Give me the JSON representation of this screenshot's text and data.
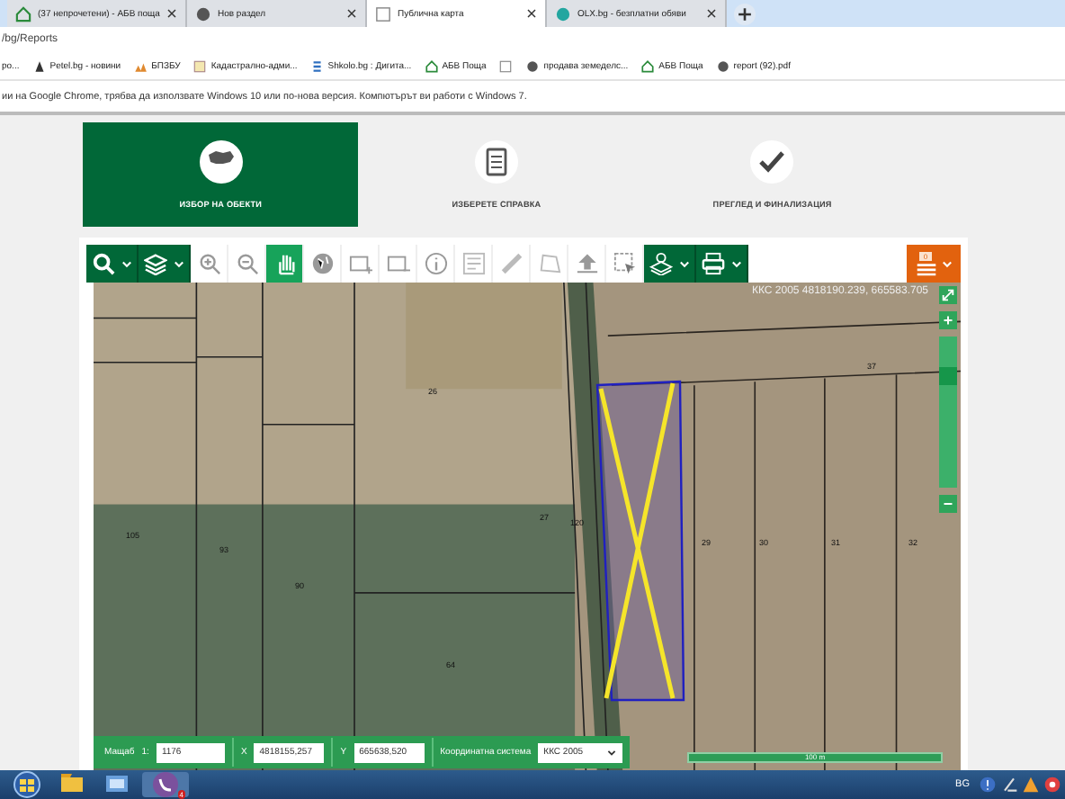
{
  "browser": {
    "tabs": [
      {
        "label": "(37 непрочетени) - АБВ поща",
        "selected": false
      },
      {
        "label": "Нов раздел",
        "selected": false
      },
      {
        "label": "Публична карта",
        "selected": true
      },
      {
        "label": "OLX.bg - безплатни обяви",
        "selected": false
      }
    ],
    "address": "/bg/Reports",
    "bookmarks": [
      {
        "kind": "link",
        "label": "ро..."
      },
      {
        "kind": "link",
        "label": "Petel.bg - новини"
      },
      {
        "kind": "link",
        "label": "БПЗБУ"
      },
      {
        "kind": "link",
        "label": "Кадастрално-адми..."
      },
      {
        "kind": "link",
        "label": "Shkolo.bg : Дигита..."
      },
      {
        "kind": "link",
        "label": "АБВ Поща"
      },
      {
        "kind": "icon"
      },
      {
        "kind": "link",
        "label": "продава земеделс..."
      },
      {
        "kind": "link",
        "label": "АБВ Поща"
      },
      {
        "kind": "link",
        "label": "report (92).pdf"
      }
    ],
    "infobar": "ии на Google Chrome, трябва да използвате Windows 10 или по-нова версия. Компютърът ви работи с Windows 7."
  },
  "steps": [
    {
      "label": "ИЗБОР НА ОБЕКТИ",
      "selected": true
    },
    {
      "label": "ИЗБЕРЕТЕ СПРАВКА",
      "selected": false
    },
    {
      "label": "ПРЕГЛЕД И ФИНАЛИЗАЦИЯ",
      "selected": false
    }
  ],
  "toolbar": [
    {
      "kind": "dropdown",
      "selected": false
    },
    {
      "kind": "dropdown",
      "selected": false
    },
    {
      "kind": "tool",
      "selected": false
    },
    {
      "kind": "tool",
      "selected": false
    },
    {
      "kind": "tool",
      "selected": true
    },
    {
      "kind": "tool",
      "selected": false
    },
    {
      "kind": "tool",
      "selected": false
    },
    {
      "kind": "tool",
      "selected": false
    },
    {
      "kind": "tool",
      "selected": false
    },
    {
      "kind": "tool",
      "selected": false
    },
    {
      "kind": "tool",
      "selected": false
    },
    {
      "kind": "tool",
      "selected": false
    },
    {
      "kind": "tool",
      "selected": false
    },
    {
      "kind": "tool",
      "selected": false
    },
    {
      "kind": "dropdown",
      "selected": false
    },
    {
      "kind": "dropdown",
      "selected": false
    }
  ],
  "cart": {
    "count": "0"
  },
  "map": {
    "coordinates": "ККС 2005 4818190.239, 665583.705",
    "zoom": {
      "level": 0.8
    },
    "parcels": [
      "26",
      "105",
      "93",
      "90",
      "64",
      "120",
      "27",
      "37",
      "29",
      "30",
      "31",
      "32"
    ],
    "scale": "100 m"
  },
  "statusbar": {
    "scale_label": "Мащаб",
    "scale_prefix": "1:",
    "scale_value": "1176",
    "x_label": "X",
    "x_value": "4818155,257",
    "y_label": "Y",
    "y_value": "665638,520",
    "crs_label": "Координатна система",
    "crs_value": "ККС 2005"
  },
  "taskbar": {
    "language": "BG",
    "badge": "4"
  }
}
